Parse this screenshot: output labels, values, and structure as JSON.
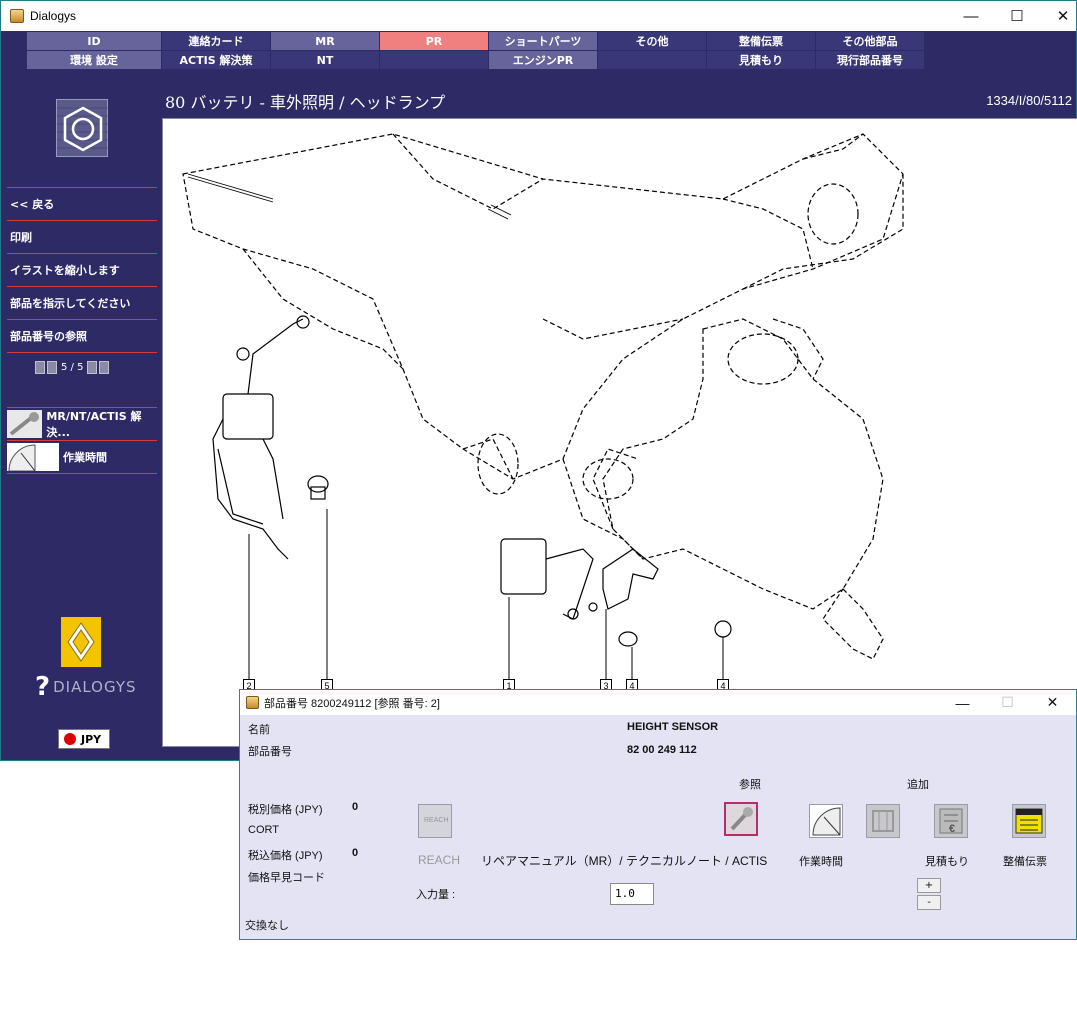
{
  "window": {
    "title": "Dialogys",
    "minimize": "—",
    "maximize": "☐",
    "close": "✕"
  },
  "tabs": {
    "row1": [
      "ID",
      "連絡カード",
      "MR",
      "PR",
      "ショートパーツ",
      "その他",
      "整備伝票",
      "その他部品"
    ],
    "row2": [
      "環境 設定",
      "ACTIS 解決策",
      "NT",
      "",
      "エンジンPR",
      "",
      "見積もり",
      "現行部品番号"
    ]
  },
  "sidebar": {
    "items": [
      "<< 戻る",
      "印刷",
      "イラストを縮小します",
      "部品を指示してください",
      "部品番号の参照"
    ],
    "pager": "5 / 5",
    "tools": [
      "MR/NT/ACTIS 解決...",
      "作業時間"
    ],
    "brand": "DIALOGYS",
    "currency": "JPY"
  },
  "content": {
    "title": "80 バッテリ - 車外照明 / ヘッドランプ",
    "ref": "1334/I/80/5112",
    "callouts": [
      "2",
      "5",
      "1",
      "3",
      "4",
      "4"
    ]
  },
  "dialog": {
    "title": "部品番号 8200249112 [参照 番号: 2]",
    "name_label": "名前",
    "name_value": "HEIGHT SENSOR",
    "part_label": "部品番号",
    "part_value": "82 00 249 112",
    "ref_header": "参照",
    "add_header": "追加",
    "price_ex_label": "税別価格 (JPY)",
    "price_ex_value": "0",
    "cort_label": "CORT",
    "price_in_label": "税込価格 (JPY)",
    "price_in_value": "0",
    "price_code_label": "価格早見コード",
    "reach_label": "REACH",
    "reach_icon_text": "REACH",
    "mr_label": "リペアマニュアル（MR）/ テクニカルノート / ACTIS",
    "labor_label": "作業時間",
    "estimate_label": "見積もり",
    "work_order_label": "整備伝票",
    "qty_label": "入力量 :",
    "qty_value": "1.0",
    "plus": "+",
    "minus": "-",
    "exchange_label": "交換なし"
  }
}
